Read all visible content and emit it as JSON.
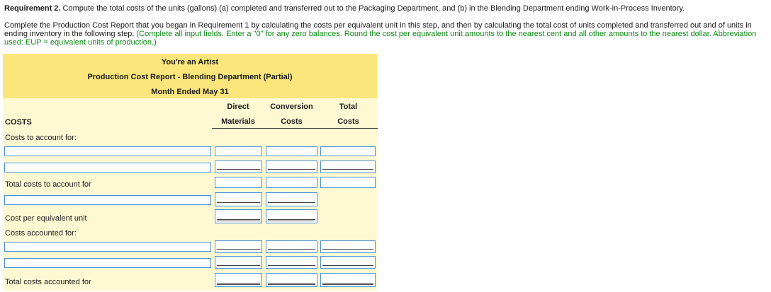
{
  "requirement": {
    "heading": "Requirement 2.",
    "text": "Compute the total costs of the units (gallons) (a) completed and transferred out to the Packaging Department, and (b) in the Blending Department ending Work-in-Process Inventory."
  },
  "instructions": {
    "text": "Complete the Production Cost Report that you began in Requirement 1 by calculating the costs per equivalent unit in this step, and then by calculating the total cost of units completed and transferred out and of units in ending inventory in the following step.",
    "hint": "(Complete all input fields. Enter a \"0\" for any zero balances. Round the cost per equivalent unit amounts to the nearest cent and all other amounts to the nearest dollar. Abbreviation used: EUP = equivalent units of production.)"
  },
  "report": {
    "company": "You're an Artist",
    "title": "Production Cost Report - Blending Department (Partial)",
    "period": "Month Ended May 31",
    "columns": {
      "dm_line1": "Direct",
      "dm_line2": "Materials",
      "cc_line1": "Conversion",
      "cc_line2": "Costs",
      "tot_line1": "Total",
      "tot_line2": "Costs"
    },
    "section_costs": "COSTS",
    "costs_to_account": "Costs to account for:",
    "total_costs_to_account": "Total costs to account for",
    "cost_per_eu": "Cost per equivalent unit",
    "costs_accounted": "Costs accounted for:",
    "total_costs_accounted": "Total costs accounted for"
  },
  "colors": {
    "title_band": "#fbe67c",
    "body_band": "#fef9d3",
    "input_border": "#4a90d9",
    "hint_text": "#0e8a16"
  }
}
